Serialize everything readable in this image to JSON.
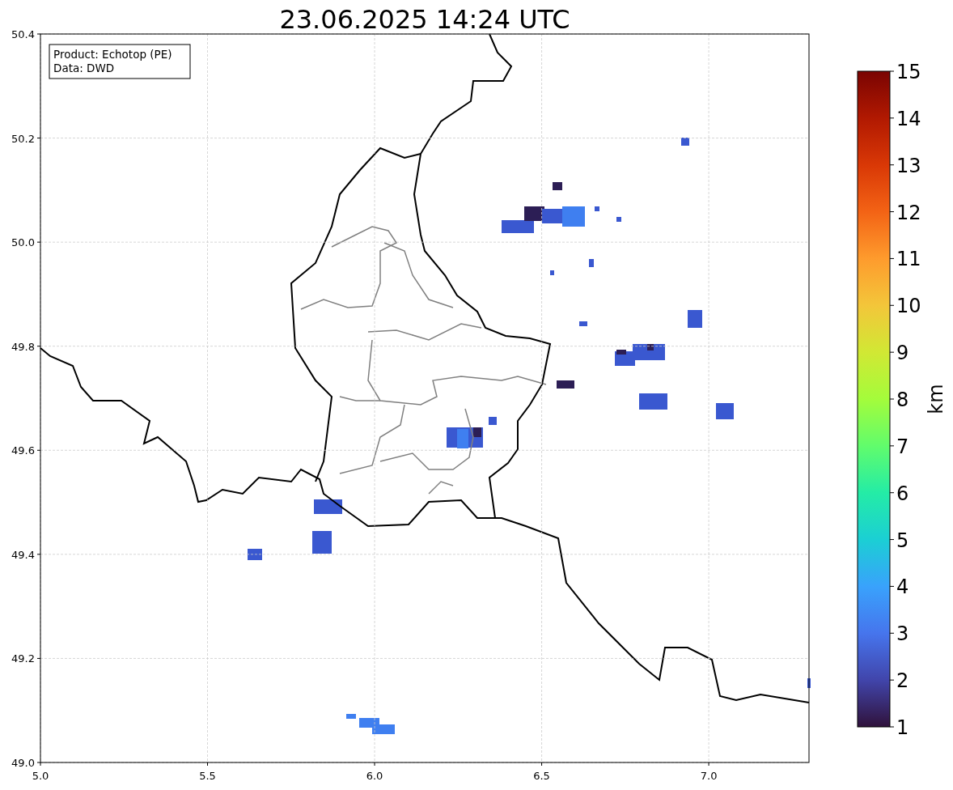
{
  "title": "23.06.2025 14:24 UTC",
  "info_box": {
    "lines": [
      "Product: Echotop (PE)",
      "Data: DWD"
    ]
  },
  "map": {
    "chart_data": {
      "type": "scatter",
      "grid": true,
      "xlim": [
        5.0,
        7.3
      ],
      "ylim": [
        49.0,
        50.4
      ],
      "xticks": [
        {
          "value": 5.0,
          "label": "5.0"
        },
        {
          "value": 5.5,
          "label": "5.5"
        },
        {
          "value": 6.0,
          "label": "6.0"
        },
        {
          "value": 6.5,
          "label": "6.5"
        },
        {
          "value": 7.0,
          "label": "7.0"
        }
      ],
      "yticks": [
        {
          "value": 49.0,
          "label": "49.0"
        },
        {
          "value": 49.2,
          "label": "49.2"
        },
        {
          "value": 49.4,
          "label": "49.4"
        },
        {
          "value": 49.6,
          "label": "49.6"
        },
        {
          "value": 49.8,
          "label": "49.8"
        },
        {
          "value": 50.0,
          "label": "50.0"
        },
        {
          "value": 50.2,
          "label": "50.2"
        },
        {
          "value": 50.4,
          "label": "50.4"
        }
      ]
    }
  },
  "colorbar": {
    "label": "km",
    "ticks": [
      "15",
      "14",
      "13",
      "12",
      "11",
      "10",
      "9",
      "8",
      "7",
      "6",
      "5",
      "4",
      "3",
      "2",
      "1"
    ]
  }
}
